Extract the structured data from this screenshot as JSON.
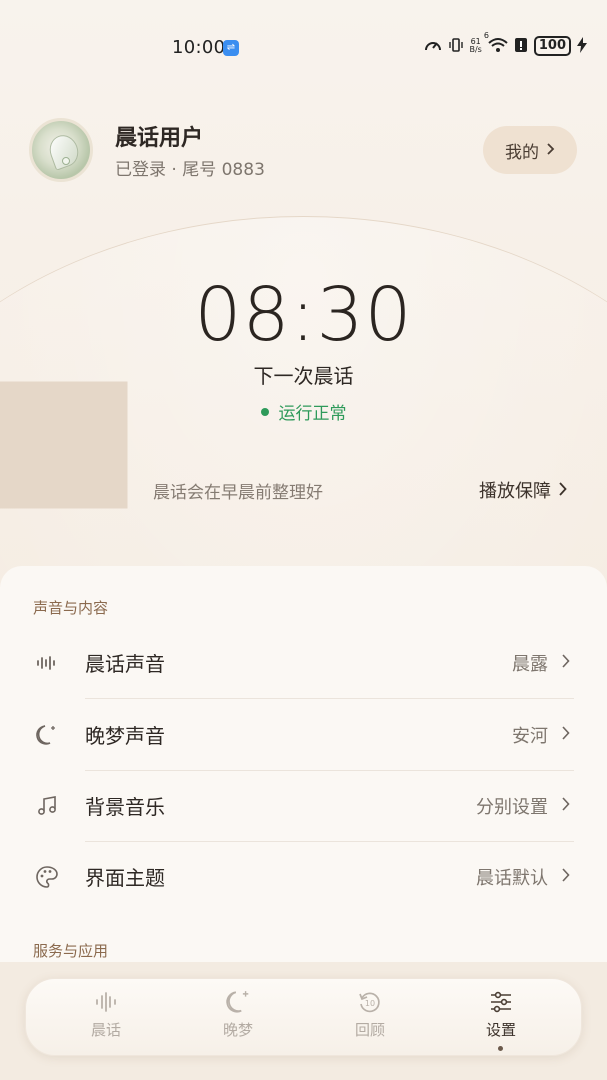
{
  "status_bar": {
    "time": "10:00",
    "network_speed_top": "61",
    "network_speed_unit": "B/s",
    "wifi_badge": "6",
    "battery": "100"
  },
  "header": {
    "user_name": "晨话用户",
    "user_sub": "已登录 · 尾号 0883",
    "mine_label": "我的"
  },
  "hero": {
    "time": "08:30",
    "next_label": "下一次晨话",
    "status": "运行正常",
    "status_color": "#2e9a5a",
    "tip": "晨话会在早晨前整理好",
    "guard_label": "播放保障"
  },
  "sections": [
    {
      "title": "声音与内容",
      "items": [
        {
          "icon": "waveform-icon",
          "label": "晨话声音",
          "value": "晨露"
        },
        {
          "icon": "moon-icon",
          "label": "晚梦声音",
          "value": "安河"
        },
        {
          "icon": "music-note-icon",
          "label": "背景音乐",
          "value": "分别设置"
        },
        {
          "icon": "palette-icon",
          "label": "界面主题",
          "value": "晨话默认"
        }
      ]
    },
    {
      "title": "服务与应用",
      "items": []
    }
  ],
  "nav": {
    "items": [
      {
        "icon": "waveform-icon",
        "label": "晨话"
      },
      {
        "icon": "moon-icon",
        "label": "晚梦"
      },
      {
        "icon": "replay-icon",
        "label": "回顾"
      },
      {
        "icon": "sliders-icon",
        "label": "设置"
      }
    ],
    "active": "设置"
  },
  "colors": {
    "background": "#f6efe6",
    "accent_brown": "#8b6a4e",
    "ok_green": "#2e9a5a"
  }
}
